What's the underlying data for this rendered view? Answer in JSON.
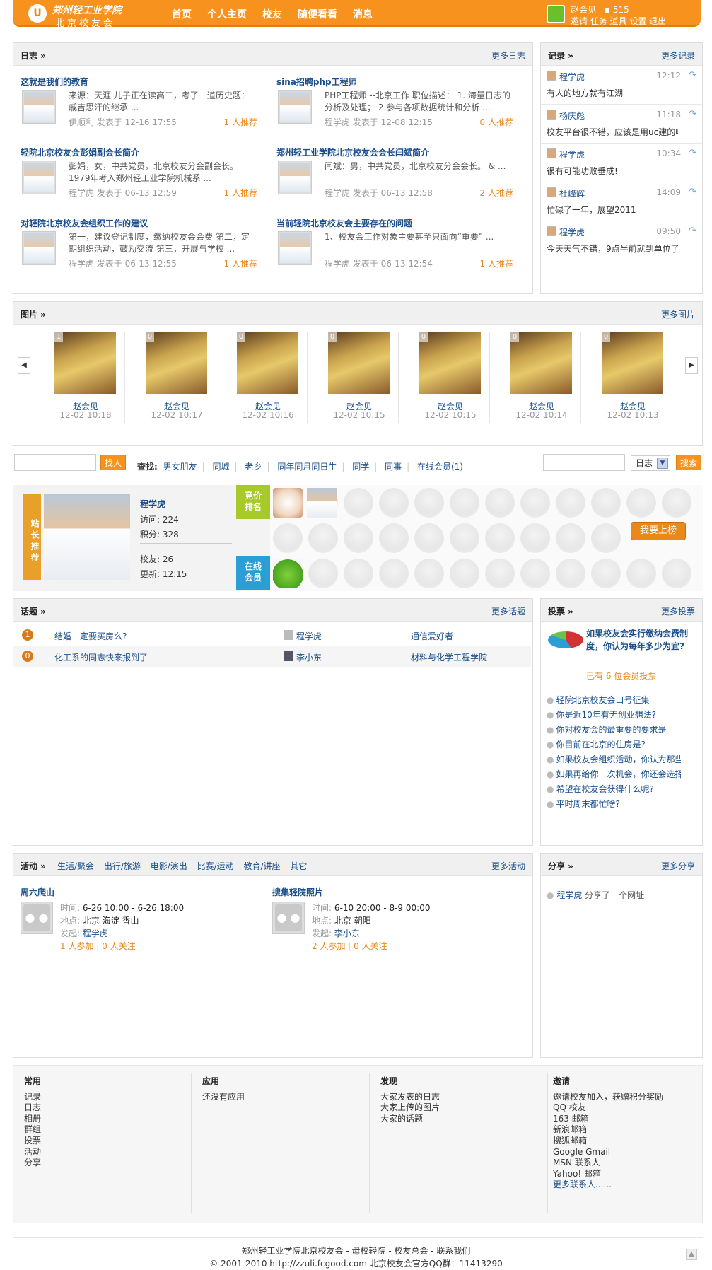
{
  "header": {
    "logo_line1": "郑州轻工业学院",
    "logo_line2": "北京校友会",
    "nav": [
      "首页",
      "个人主页",
      "校友",
      "随便看看",
      "消息"
    ],
    "user_name": "赵会见",
    "user_points": "515",
    "user_links": "邀请 任务 道具 设置 退出"
  },
  "blogs": {
    "title": "日志 »",
    "more": "更多日志",
    "items": [
      {
        "title": "这就是我们的教育",
        "excerpt": "来源：天涯 儿子正在读高二，考了一道历史题：戚吉思汗的继承 ...",
        "meta": "伊顺利 发表于 12-16 17:55",
        "rec": "1 人推荐"
      },
      {
        "title": "sina招聘php工程师",
        "excerpt": "PHP工程师 --北京工作 职位描述： 1. 海量日志的分析及处理； 2.参与各项数据统计和分析 ...",
        "meta": "程学虎 发表于 12-08 12:15",
        "rec": "0 人推荐"
      },
      {
        "title": "轻院北京校友会彭娟副会长简介",
        "excerpt": "彭娟，女，中共党员，北京校友分会副会长。 1979年考入郑州轻工业学院机械系 ...",
        "meta": "程学虎 发表于 06-13 12:59",
        "rec": "1 人推荐"
      },
      {
        "title": "郑州轻工业学院北京校友会会长闫斌简介",
        "excerpt": "闫斌：男，中共党员，北京校友分会会长。 & ...",
        "meta": "程学虎 发表于 06-13 12:58",
        "rec": "2 人推荐"
      },
      {
        "title": "对轻院北京校友会组织工作的建议",
        "excerpt": "第一，建议登记制度，缴纳校友会会费 第二，定期组织活动，鼓励交流 第三，开展与学校 ...",
        "meta": "程学虎 发表于 06-13 12:55",
        "rec": "1 人推荐"
      },
      {
        "title": "当前轻院北京校友会主要存在的问题",
        "excerpt": "1、校友会工作对象主要甚至只面向“重要” ...",
        "meta": "程学虎 发表于 06-13 12:54",
        "rec": "1 人推荐"
      }
    ]
  },
  "records": {
    "title": "记录 »",
    "more": "更多记录",
    "items": [
      {
        "name": "程学虎",
        "time": "12:12",
        "text": "有人的地方就有江湖"
      },
      {
        "name": "杨庆彪",
        "time": "11:18",
        "text": "校友平台很不错，应该是用uc建的吧..."
      },
      {
        "name": "程学虎",
        "time": "10:34",
        "text": "很有可能功败垂成!"
      },
      {
        "name": "杜峰辉",
        "time": "14:09",
        "text": "忙碌了一年，展望2011"
      },
      {
        "name": "程学虎",
        "time": "09:50",
        "text": "今天天气不错，9点半前就到单位了"
      }
    ]
  },
  "photos": {
    "title": "图片 »",
    "more": "更多图片",
    "items": [
      {
        "count": "1",
        "name": "赵会见",
        "time": "12-02 10:18"
      },
      {
        "count": "0",
        "name": "赵会见",
        "time": "12-02 10:17"
      },
      {
        "count": "0",
        "name": "赵会见",
        "time": "12-02 10:16"
      },
      {
        "count": "0",
        "name": "赵会见",
        "time": "12-02 10:15"
      },
      {
        "count": "0",
        "name": "赵会见",
        "time": "12-02 10:15"
      },
      {
        "count": "0",
        "name": "赵会见",
        "time": "12-02 10:14"
      },
      {
        "count": "0",
        "name": "赵会见",
        "time": "12-02 10:13"
      }
    ]
  },
  "search": {
    "find_button": "找人",
    "find_label": "查找:",
    "links": [
      "男女朋友",
      "同城",
      "老乡",
      "同年同月同日生",
      "同学",
      "同事",
      "在线会员(1)"
    ],
    "type_select": "日志",
    "search_button": "搜索"
  },
  "featured": {
    "badge": "站长推荐",
    "name": "程学虎",
    "visits": "访问: 224",
    "points": "积分: 328",
    "friends": "校友: 26",
    "updated": "更新: 12:15",
    "bid_label": "竞价排名",
    "online_label": "在线会员",
    "list_button": "我要上榜"
  },
  "topics": {
    "title": "话题 »",
    "more": "更多话题",
    "items": [
      {
        "replies": "1",
        "title": "结婚一定要买房么?",
        "user": "程学虎",
        "group": "通信爱好者"
      },
      {
        "replies": "0",
        "title": "化工系的同志快来报到了",
        "user": "李小东",
        "group": "材料与化学工程学院"
      }
    ]
  },
  "poll": {
    "title": "投票 »",
    "more": "更多投票",
    "featured_title": "如果校友会实行缴纳会费制度，你认为每年多少为宜?",
    "featured_votes": "已有 6 位会员投票",
    "items": [
      "轻院北京校友会口号征集",
      "你是近10年有无创业想法?",
      "你对校友会的最重要的要求是",
      "你目前在北京的住房是?",
      "如果校友会组织活动，你认为那些...",
      "如果再给你一次机会，你还会选择...",
      "希望在校友会获得什么呢?",
      "平时周末都忙啥?"
    ]
  },
  "events": {
    "title": "活动 »",
    "categories": [
      "生活/聚会",
      "出行/旅游",
      "电影/演出",
      "比赛/运动",
      "教育/讲座",
      "其它"
    ],
    "more": "更多活动",
    "time_label": "时间:",
    "place_label": "地点:",
    "organizer_label": "发起:",
    "items": [
      {
        "title": "周六爬山",
        "time": "6-26 10:00 - 6-26 18:00",
        "place": "北京 海淀 香山",
        "organizer": "程学虎",
        "join": "1 人参加",
        "follow": "0 人关注"
      },
      {
        "title": "搜集轻院照片",
        "time": "6-10 20:00 - 8-9 00:00",
        "place": "北京 朝阳",
        "organizer": "李小东",
        "join": "2 人参加",
        "follow": "0 人关注"
      }
    ]
  },
  "share": {
    "title": "分享 »",
    "more": "更多分享",
    "user": "程学虎",
    "text": "分享了一个网址"
  },
  "footer": {
    "common": {
      "title": "常用",
      "items": [
        "记录",
        "日志",
        "相册",
        "群组",
        "投票",
        "活动",
        "分享"
      ]
    },
    "apps": {
      "title": "应用",
      "items": [
        "还没有应用"
      ]
    },
    "discover": {
      "title": "发现",
      "items": [
        "大家发表的日志",
        "大家上传的图片",
        "大家的话题"
      ]
    },
    "invite": {
      "title": "邀请",
      "items": [
        "邀请校友加入，获赠积分奖励",
        "QQ 校友",
        "163 邮箱",
        "新浪邮箱",
        "搜狐邮箱",
        "Google Gmail",
        "MSN 联系人",
        "Yahoo! 邮箱",
        "更多联系人......"
      ]
    },
    "bottom_links": "郑州轻工业学院北京校友会 - 母校轻院 - 校友总会 - 联系我们",
    "copyright": "© 2001-2010 http://zzuli.fcgood.com 北京校友会官方QQ群：11413290"
  }
}
